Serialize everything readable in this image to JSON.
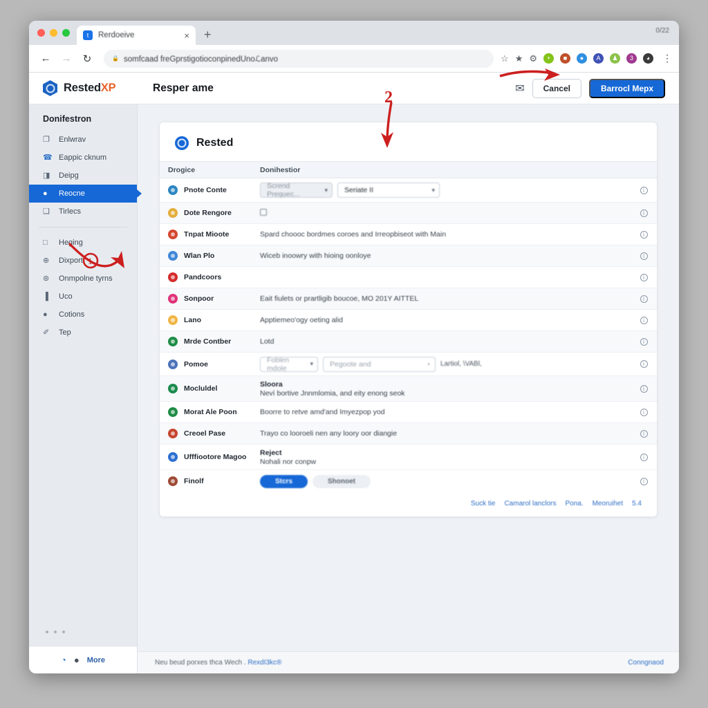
{
  "browser": {
    "tab": {
      "title": "Rerdoeive",
      "favicon_letter": "t",
      "close_label": "×",
      "new_tab_label": "+"
    },
    "window_meta": "0/22",
    "nav": {
      "back": "←",
      "forward": "→",
      "reload": "↻"
    },
    "omnibox": {
      "lock_icon": "🔒",
      "url": "somfcaad freGprstigotioconpinedUnoℒanvo"
    },
    "toolbar_icons": [
      {
        "name": "bookmark-star-icon",
        "glyph": "☆",
        "color": "#5f6368"
      },
      {
        "name": "favorite-star-icon",
        "glyph": "★",
        "color": "#5f6368"
      },
      {
        "name": "puzzle-extension-icon",
        "glyph": "⚙",
        "color": "#5f6368"
      },
      {
        "name": "extension-green-icon",
        "glyph": "+",
        "color": "#84c318"
      },
      {
        "name": "extension-stamp-icon",
        "glyph": "■",
        "color": "#c0502a"
      },
      {
        "name": "extension-blue-icon",
        "glyph": "●",
        "color": "#2e8fe0"
      },
      {
        "name": "extension-azure-icon",
        "glyph": "A",
        "color": "#3f51b5"
      },
      {
        "name": "extension-lime-icon",
        "glyph": "♟",
        "color": "#8bc34a"
      },
      {
        "name": "extension-purple-icon",
        "glyph": "3",
        "color": "#a0398f"
      },
      {
        "name": "extension-dark-icon",
        "glyph": "◑",
        "color": "#3a3a3a"
      }
    ],
    "menu_glyph": "⋮"
  },
  "appbar": {
    "brand_prefix": "Rested",
    "brand_suffix": "XP",
    "page_title": "Resper ame",
    "note_icon": "✉",
    "cancel_label": "Cancel",
    "primary_label": "Barrocl Mepx"
  },
  "sidebar": {
    "heading": "Donifestron",
    "group_one": [
      {
        "label": "Enlwrav",
        "icon": "❐"
      },
      {
        "label": "Eappic cknum",
        "icon": "☎"
      },
      {
        "label": "Deipg",
        "icon": "◨"
      },
      {
        "label": "Reocne",
        "icon": "●",
        "active": true
      },
      {
        "label": "Tirlecs",
        "icon": "❑"
      }
    ],
    "group_two": [
      {
        "label": "Heging",
        "icon": "□"
      },
      {
        "label": "Dixport",
        "icon": "⊕"
      },
      {
        "label": "Onmpolne tyrns",
        "icon": "⊛"
      },
      {
        "label": "Uco",
        "icon": "▐"
      },
      {
        "label": "Cotions",
        "icon": "●"
      },
      {
        "label": "Tep",
        "icon": "✐"
      }
    ],
    "footer": {
      "brand_icon": "◔",
      "user_icon": "●",
      "more_label": "More"
    }
  },
  "card": {
    "title": "Rested",
    "columns": {
      "a": "Drogice",
      "b": "Donihestior",
      "c": ""
    },
    "rows": [
      {
        "label": "Pnote Conte",
        "icon_color": "#2c86c2",
        "kind": "two-selects",
        "select_muted": "Scrend Prequec...",
        "select_value": "Seriate II"
      },
      {
        "label": "Dote Rengore",
        "icon_color": "#e3ae3b",
        "kind": "checkbox",
        "text": ""
      },
      {
        "label": "Tnpat Mioote",
        "icon_color": "#d4452e",
        "kind": "text",
        "text": "Spard choooc bordmes coroes and Irreopbiseot with Main"
      },
      {
        "label": "Wlan Plo",
        "icon_color": "#3f87d8",
        "kind": "text",
        "text": "Wiceb inoowry with hioing oonloye"
      },
      {
        "label": "Pandcoors",
        "icon_color": "#d42c2c",
        "kind": "redacted",
        "text": ""
      },
      {
        "label": "Sonpoor",
        "icon_color": "#e0327a",
        "kind": "text",
        "text": "Eait fiulets or prartligib boucoe, MO 201Y AITTEL"
      },
      {
        "label": "Lano",
        "icon_color": "#f0b545",
        "kind": "text",
        "text": "Apptiemeo'ogy oeting alid"
      },
      {
        "label": "Mrde Contber",
        "icon_color": "#1f8c46",
        "kind": "text",
        "text": "Lotd"
      },
      {
        "label": "Pomoe",
        "icon_color": "#4c72b8",
        "kind": "inline-controls",
        "select_value": "Foblen mdole",
        "input_placeholder": "Pegoote and",
        "input_icon": "◔",
        "note": "Lartiol, \\VABl,"
      },
      {
        "label": "Mocluldel",
        "icon_color": "#1b8a4e",
        "kind": "two-line",
        "title": "Sloora",
        "text": "Neví bortive Jnnmlomia, and eity enong seok"
      },
      {
        "label": "Morat Ale Poon",
        "icon_color": "#1f8c46",
        "kind": "text",
        "text": "Boorre to retve amd'and Imyezpop yod"
      },
      {
        "label": "Creoel Pase",
        "icon_color": "#c6452f",
        "kind": "text",
        "text": "Trayo co looroeli nen any loory oor diangie"
      },
      {
        "label": "Ufffiootore Magoo",
        "icon_color": "#2d6fd1",
        "kind": "two-line",
        "title": "Reject",
        "text": "Nohali nor conpw"
      },
      {
        "label": "Finolf",
        "icon_color": "#9e4a36",
        "kind": "pills",
        "pill_on": "Stcrs",
        "pill_off": "Shonoet"
      }
    ],
    "info_icon": "i",
    "footer_links": [
      "Suck tie",
      "Camarol lanclors",
      "Pona.",
      "Meoruihet",
      "5.4"
    ]
  },
  "page_footer": {
    "text_left": "Neu beud porxes thca Wech .",
    "link_inline": "RexdI3kc®",
    "link_right": "Conngnaod"
  },
  "annotations": [
    {
      "name": "callout-number-2",
      "value": "2"
    },
    {
      "name": "callout-number-1",
      "value": "1"
    }
  ],
  "colors": {
    "accent": "#1668d6",
    "brand_orange": "#e8622a",
    "annotation_red": "#cc1f1f",
    "sidebar_bg": "#e7ebf0"
  }
}
